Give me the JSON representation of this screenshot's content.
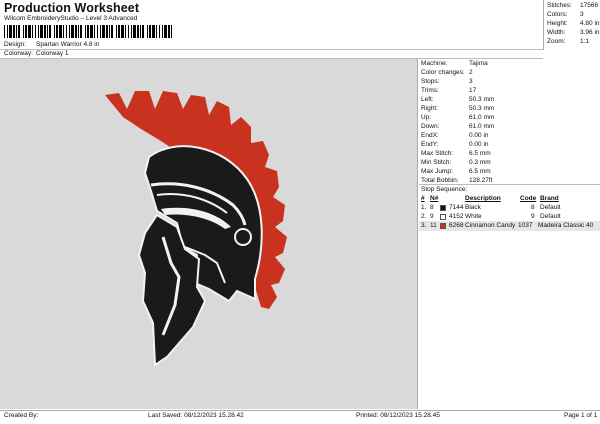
{
  "header": {
    "title": "Production Worksheet",
    "subtitle": "Wilcom EmbroideryStudio – Level 3 Advanced",
    "design_label": "Design:",
    "design_value": "Spartan Warrior 4.8 in",
    "colorway_label": "Colorway:",
    "colorway_value": "Colorway 1"
  },
  "stats": [
    {
      "label": "Stitches:",
      "value": "17566"
    },
    {
      "label": "Colors:",
      "value": "3"
    },
    {
      "label": "Height:",
      "value": "4.80 in"
    },
    {
      "label": "Width:",
      "value": "3.96 in"
    },
    {
      "label": "Zoom:",
      "value": "1:1"
    }
  ],
  "properties": [
    {
      "label": "Machine:",
      "value": "Tajima"
    },
    {
      "label": "Color changes:",
      "value": "2"
    },
    {
      "label": "Stops:",
      "value": "3"
    },
    {
      "label": "Trims:",
      "value": "17"
    },
    {
      "label": "Left:",
      "value": "50.3 mm"
    },
    {
      "label": "Right:",
      "value": "50.3 mm"
    },
    {
      "label": "Up:",
      "value": "61.0 mm"
    },
    {
      "label": "Down:",
      "value": "61.0 mm"
    },
    {
      "label": "EndX:",
      "value": "0.00 in"
    },
    {
      "label": "EndY:",
      "value": "0.00 in"
    },
    {
      "label": "Max Stitch:",
      "value": "6.5 mm"
    },
    {
      "label": "Min Stitch:",
      "value": "0.3 mm"
    },
    {
      "label": "Max Jump:",
      "value": "6.5 mm"
    },
    {
      "label": "Total Bobbin:",
      "value": "128.27ft"
    }
  ],
  "stop_sequence": {
    "title": "Stop Sequence:",
    "headers": {
      "num": "#",
      "n": "N#",
      "description": "Description",
      "code": "Code",
      "brand": "Brand"
    },
    "rows": [
      {
        "num": "1.",
        "n": "8",
        "color": "#111111",
        "thread": "7144",
        "description": "Black",
        "code": "8",
        "brand": "Default"
      },
      {
        "num": "2.",
        "n": "9",
        "color": "#ffffff",
        "thread": "4152",
        "description": "White",
        "code": "9",
        "brand": "Default"
      },
      {
        "num": "3.",
        "n": "11",
        "color": "#c8321e",
        "thread": "6268",
        "description": "Cinnamon Candy",
        "code": "1037",
        "brand": "Madeira Classic 40"
      }
    ]
  },
  "footer": {
    "created_by": "Created By:",
    "last_saved": "Last Saved: 08/12/2023 15.28.42",
    "printed": "Printed: 08/12/2023 15.28.45",
    "page": "Page 1 of 1"
  },
  "colors": {
    "preview_bg": "#d9d9d9",
    "plume": "#c8321e",
    "helmet": "#1a1a1a",
    "outline": "#f2f2f2"
  }
}
